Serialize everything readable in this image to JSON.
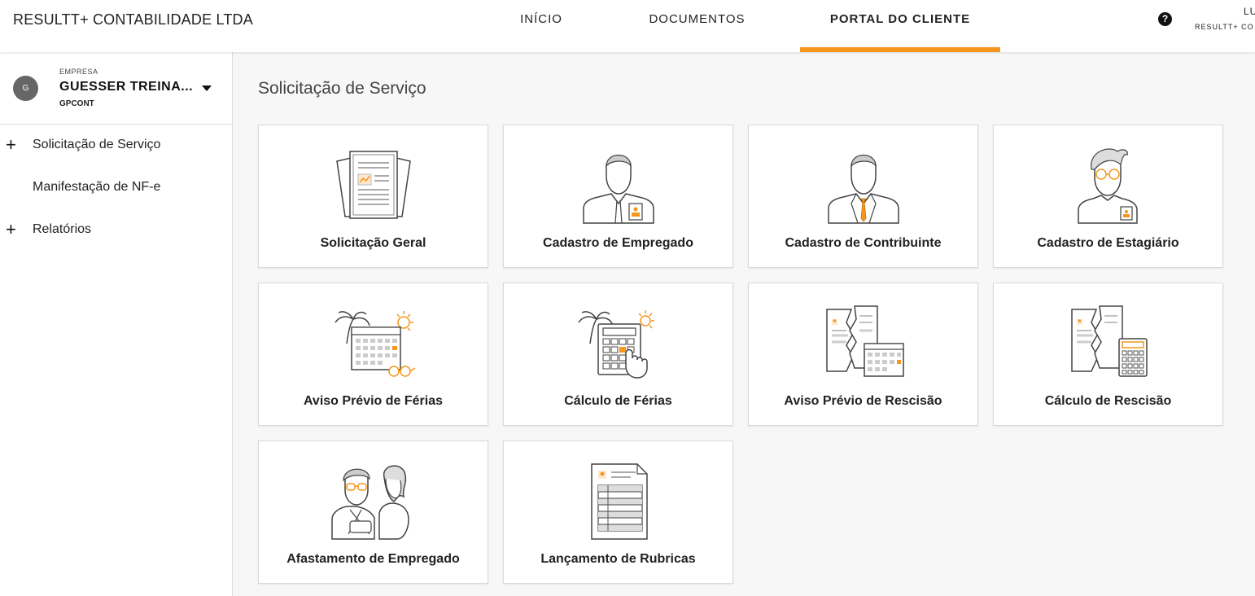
{
  "app": {
    "brand": "RESULTT+ CONTABILIDADE LTDA",
    "accent_color": "#f5961d"
  },
  "nav": {
    "items": [
      {
        "label": "INÍCIO",
        "active": false
      },
      {
        "label": "DOCUMENTOS",
        "active": false
      },
      {
        "label": "PORTAL DO CLIENTE",
        "active": true
      }
    ]
  },
  "user": {
    "help_icon": "?",
    "name": "LU",
    "company": "RESULTT+ CO"
  },
  "sidebar": {
    "company": {
      "avatar": "G",
      "caption": "EMPRESA",
      "name": "GUESSER TREINA...",
      "code": "GPCONT"
    },
    "items": [
      {
        "label": "Solicitação de Serviço",
        "expandable": true,
        "icon": "plus-icon"
      },
      {
        "label": "Manifestação de NF-e",
        "expandable": false
      },
      {
        "label": "Relatórios",
        "expandable": true,
        "icon": "plus-icon"
      }
    ]
  },
  "main": {
    "title": "Solicitação de Serviço",
    "cards": [
      {
        "label": "Solicitação Geral",
        "icon": "documents-icon"
      },
      {
        "label": "Cadastro de Empregado",
        "icon": "employee-icon"
      },
      {
        "label": "Cadastro de Contribuinte",
        "icon": "contributor-icon"
      },
      {
        "label": "Cadastro de Estagiário",
        "icon": "intern-icon"
      },
      {
        "label": "Aviso Prévio de Férias",
        "icon": "vacation-calendar-icon"
      },
      {
        "label": "Cálculo de Férias",
        "icon": "vacation-calculator-icon"
      },
      {
        "label": "Aviso Prévio de Rescisão",
        "icon": "termination-calendar-icon"
      },
      {
        "label": "Cálculo de Rescisão",
        "icon": "termination-calculator-icon"
      },
      {
        "label": "Afastamento de Empregado",
        "icon": "leave-icon"
      },
      {
        "label": "Lançamento de Rubricas",
        "icon": "rubrics-sheet-icon"
      }
    ]
  }
}
